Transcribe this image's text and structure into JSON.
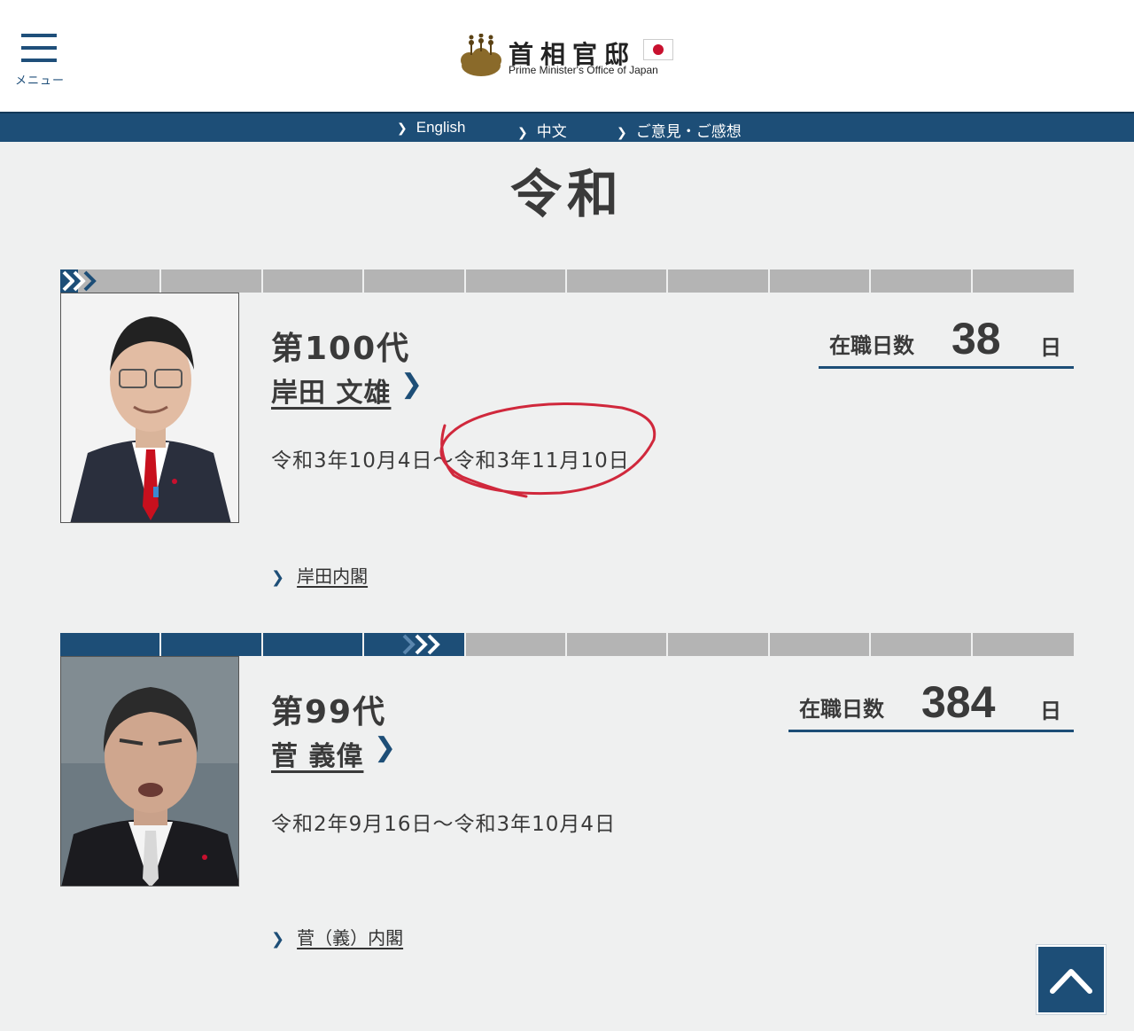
{
  "header": {
    "menu_label": "メニュー",
    "site_title_jp": "首相官邸",
    "site_title_en": "Prime Minister's Office of Japan"
  },
  "lang_bar": {
    "links": [
      "English",
      "中文",
      "ご意見・ご感想"
    ]
  },
  "era_title": "令和",
  "prime_ministers": [
    {
      "generation": "第100代",
      "name": "岸田 文雄",
      "term": "令和3年10月4日～令和3年11月10日",
      "days_label": "在職日数",
      "days_value": "38",
      "days_unit": "日",
      "cabinet_link": "岸田内閣",
      "progress_fraction": 0.0
    },
    {
      "generation": "第99代",
      "name": "菅 義偉",
      "term": "令和2年9月16日～令和3年10月4日",
      "days_label": "在職日数",
      "days_value": "384",
      "days_unit": "日",
      "cabinet_link": "菅（義）内閣",
      "progress_fraction": 0.4
    }
  ],
  "colors": {
    "accent": "#1d4e77",
    "annotation": "#d0283c",
    "flag_sun": "#c8102e"
  }
}
